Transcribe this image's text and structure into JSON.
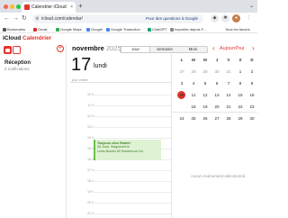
{
  "browser": {
    "tab_title": "Calendrier iCloud",
    "tab_close": "×",
    "new_tab": "+",
    "url": "icloud.com/calendar/",
    "promo": "Pour des questions à Google",
    "bookmarks": [
      {
        "label": "Bookmarks",
        "color": "#555555"
      },
      {
        "label": "Gmail",
        "color": "#d93025"
      },
      {
        "label": "Google Maps",
        "color": "#34a853"
      },
      {
        "label": "Google",
        "color": "#4285f4"
      },
      {
        "label": "Google Traduction",
        "color": "#4285f4"
      },
      {
        "label": "ChatGPT",
        "color": "#10a37f"
      },
      {
        "label": "Importés depuis F...",
        "color": "#888888"
      }
    ],
    "bookmarks_all": "Tous les favoris"
  },
  "app": {
    "brand_apple": "",
    "brand_icloud": "iCloud",
    "brand_calendar": "Calendrier",
    "accent": "#e3342f"
  },
  "sidebar": {
    "title": "Réception",
    "subtitle": "0 notifications",
    "add_icon": "+"
  },
  "header": {
    "month": "novembre",
    "year": "2025",
    "views": [
      "Jour",
      "Semaine",
      "Mois"
    ],
    "active_view": "Jour",
    "prev": "‹",
    "today": "Aujourd'hui",
    "next": "›"
  },
  "day": {
    "number": "17",
    "name": "lundi",
    "allday": "jour entier",
    "hours": [
      "10 h",
      "11 h",
      "12 h",
      "13 h",
      "14 h",
      "15 h",
      "16 h",
      "17 h",
      "18 h",
      "19 h",
      "20 h",
      "21 h"
    ]
  },
  "event": {
    "time_title": "Toujours chez Robert",
    "line2": "26, bout. Seigneuret le",
    "line3": "Louis Boudin 69 Sombernon Dn"
  },
  "minical": {
    "weekdays": [
      "L",
      "M",
      "M",
      "J",
      "V",
      "S",
      "D"
    ],
    "weeks": [
      [
        "27",
        "28",
        "29",
        "30",
        "31",
        "1",
        "2"
      ],
      [
        "3",
        "4",
        "5",
        "6",
        "7",
        "8",
        "9"
      ],
      [
        "10",
        "11",
        "12",
        "13",
        "14",
        "15",
        "16"
      ],
      [
        "17",
        "18",
        "19",
        "20",
        "21",
        "22",
        "23"
      ],
      [
        "24",
        "25",
        "26",
        "27",
        "28",
        "29",
        "30"
      ]
    ],
    "today": "17"
  },
  "right": {
    "no_event": "Aucun événement sélectionné"
  }
}
